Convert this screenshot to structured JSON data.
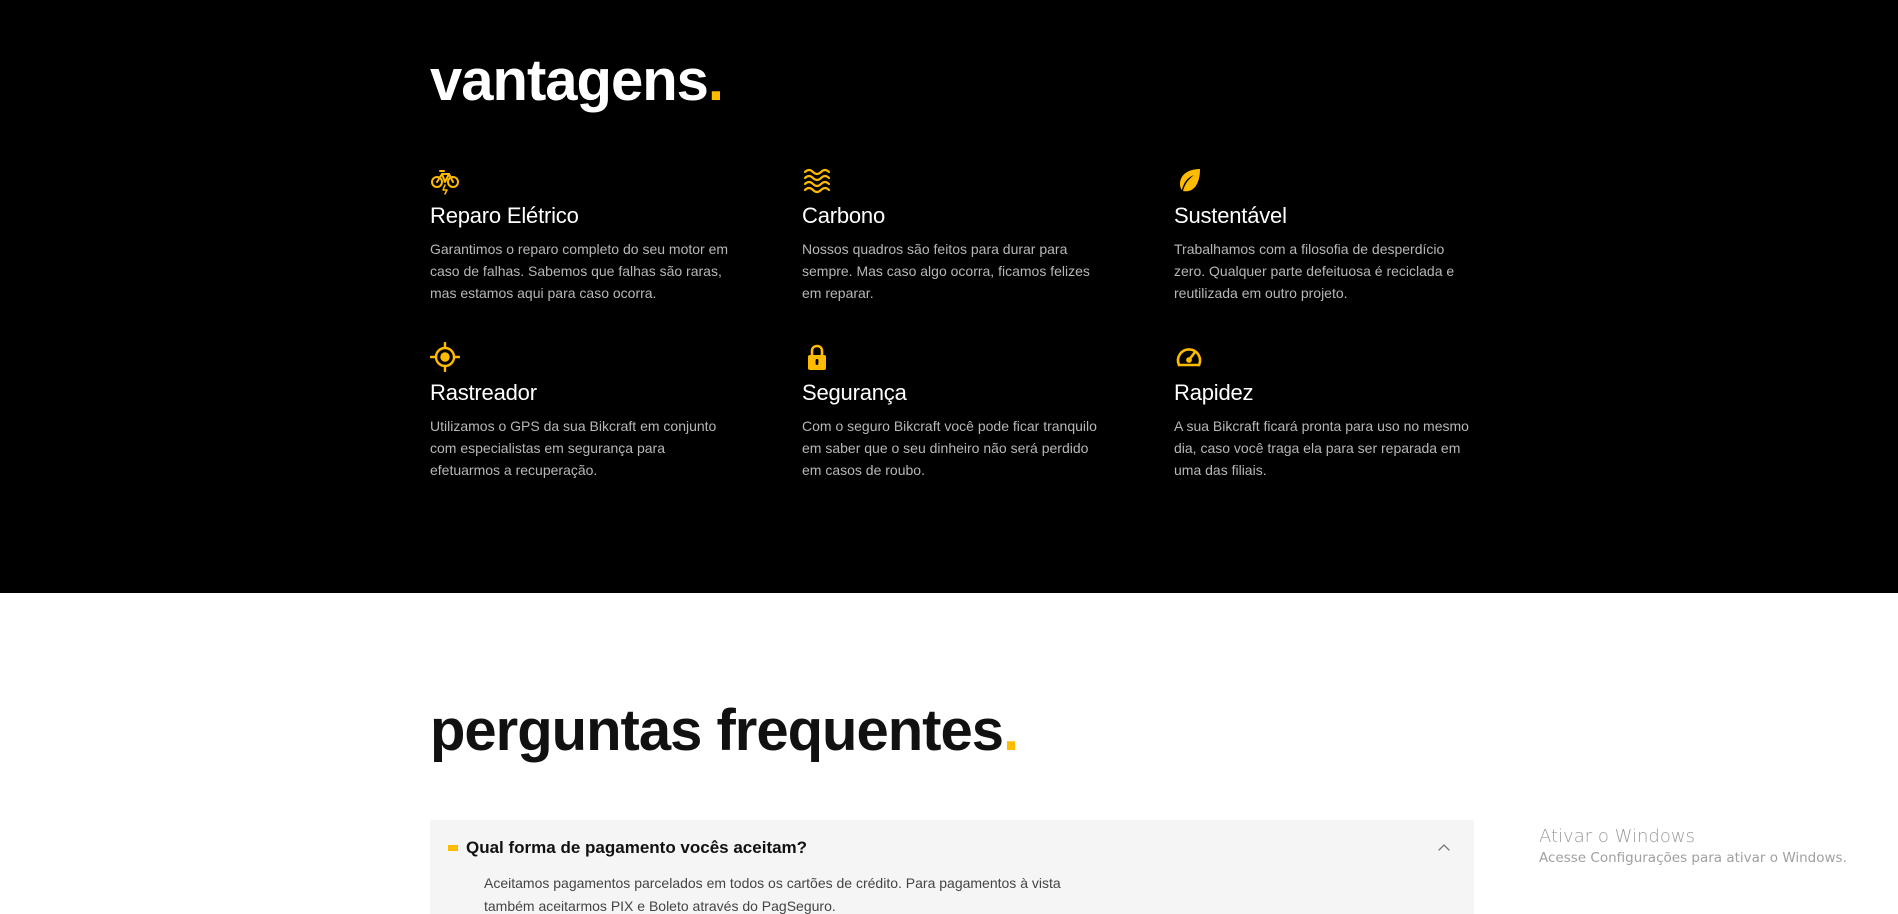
{
  "advantages": {
    "title": "vantagens",
    "title_dot": ".",
    "accent_color": "#ffbb00",
    "items": [
      {
        "icon": "electric-bike-icon",
        "title": "Reparo Elétrico",
        "text": "Garantimos o reparo completo do seu motor em caso de falhas. Sabemos que falhas são raras, mas estamos aqui para caso ocorra."
      },
      {
        "icon": "waves-icon",
        "title": "Carbono",
        "text": "Nossos quadros são feitos para durar para sempre. Mas caso algo ocorra, ficamos felizes em reparar."
      },
      {
        "icon": "leaf-icon",
        "title": "Sustentável",
        "text": "Trabalhamos com a filosofia de desperdício zero. Qualquer parte defeituosa é reciclada e reutilizada em outro projeto."
      },
      {
        "icon": "target-icon",
        "title": "Rastreador",
        "text": "Utilizamos o GPS da sua Bikcraft em conjunto com especialistas em segurança para efetuarmos a recuperação."
      },
      {
        "icon": "lock-icon",
        "title": "Segurança",
        "text": "Com o seguro Bikcraft você pode ficar tranquilo em saber que o seu dinheiro não será perdido em casos de roubo."
      },
      {
        "icon": "speedometer-icon",
        "title": "Rapidez",
        "text": "A sua Bikcraft ficará pronta para uso no mesmo dia, caso você traga ela para ser reparada em uma das filiais."
      }
    ]
  },
  "faq": {
    "title": "perguntas frequentes",
    "title_dot": ".",
    "items": [
      {
        "question": "Qual forma de pagamento vocês aceitam?",
        "answer": "Aceitamos pagamentos parcelados em todos os cartões de crédito. Para pagamentos à vista também aceitarmos PIX e Boleto através do PagSeguro.",
        "expanded": true
      }
    ]
  },
  "watermark": {
    "line1": "Ativar o Windows",
    "line2": "Acesse Configurações para ativar o Windows."
  }
}
